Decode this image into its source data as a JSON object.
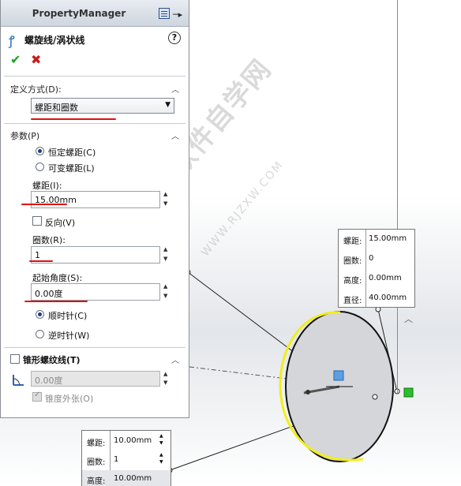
{
  "property_manager": {
    "header_title": "PropertyManager",
    "feature_title": "螺旋线/涡状线",
    "help_label": "?",
    "ok_label": "✔",
    "cancel_label": "✖"
  },
  "definition": {
    "section_title": "定义方式(D):",
    "selected": "螺距和圈数"
  },
  "parameters": {
    "section_title": "参数(P)",
    "radio_constant": "恒定螺距(C)",
    "radio_variable": "可变螺距(L)",
    "pitch_label": "螺距(I):",
    "pitch_value": "15.00mm",
    "reverse_label": "反向(V)",
    "revolutions_label": "圈数(R):",
    "revolutions_value": "1",
    "start_angle_label": "起始角度(S):",
    "start_angle_value": "0.00度",
    "radio_clockwise": "顺时针(C)",
    "radio_counterclockwise": "逆时针(W)"
  },
  "taper": {
    "section_title": "锥形螺纹线(T)",
    "angle_value": "0.00度",
    "taper_outward_label": "锥度外张(O)"
  },
  "callout_right": {
    "rows": [
      {
        "key": "螺距:",
        "value": "15.00mm"
      },
      {
        "key": "圈数:",
        "value": "0"
      },
      {
        "key": "高度:",
        "value": "0.00mm"
      },
      {
        "key": "直径:",
        "value": "40.00mm"
      }
    ]
  },
  "callout_bottom": {
    "rows": [
      {
        "key": "螺距:",
        "value": "10.00mm"
      },
      {
        "key": "圈数:",
        "value": "1"
      },
      {
        "key": "高度:",
        "value": "10.00mm"
      }
    ]
  },
  "watermark": {
    "main": "软件自学网",
    "sub": "WWW.RJZXW.COM"
  },
  "colors": {
    "accent_blue": "#2a66b8",
    "ok_green": "#1aa31a",
    "cancel_red": "#cc1a1a",
    "annotation_red": "#e01010",
    "helix_yellow": "#f2ee1a"
  }
}
